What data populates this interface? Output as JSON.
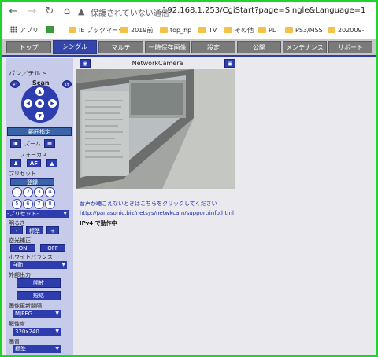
{
  "browser": {
    "security_text": "保護されていない通信",
    "url": "192.168.1.253/CgiStart?page=Single&Language=1",
    "bookmarks": [
      "アプリ",
      "IE ブックマーク",
      "2019前",
      "top_hp",
      "TV",
      "その他",
      "PL",
      "PS3/MSS",
      "202009-"
    ]
  },
  "tabs": [
    "トップ",
    "シングル",
    "マルチ",
    "一時保存画像",
    "設定",
    "公開",
    "メンテナンス",
    "サポート"
  ],
  "active_tab": "シングル",
  "camera_title": "NetworkCamera",
  "left": {
    "pan_tilt": "パン／チルト",
    "scan": "Scan",
    "range": "範囲指定",
    "zoom": "ズーム",
    "focus": "フォーカス",
    "af": "AF",
    "preset": "プリセット",
    "register": "登録",
    "preset_numbers": [
      "1",
      "2",
      "3",
      "4",
      "5",
      "6",
      "7",
      "8"
    ],
    "preset_select": "-プリセット-",
    "brightness": "明るさ",
    "minus": "-",
    "standard": "標準",
    "plus": "+",
    "backlight": "逆光補正",
    "on": "ON",
    "off": "OFF",
    "white_balance": "ホワイトバランス",
    "wb_value": "自動",
    "ext_output": "外部出力",
    "open": "開放",
    "short": "短絡",
    "refresh": "画像更新間隔",
    "refresh_value": "MJPEG",
    "resolution": "解像度",
    "resolution_value": "320x240",
    "quality": "画質",
    "quality_value": "標準"
  },
  "main": {
    "audio_link": "音声が聴こえないときはこちらをクリックしてください",
    "support_url": "http://panasonic.biz/netsys/netwkcam/support/info.html",
    "ipv4_status": "IPv4 で動作中"
  }
}
